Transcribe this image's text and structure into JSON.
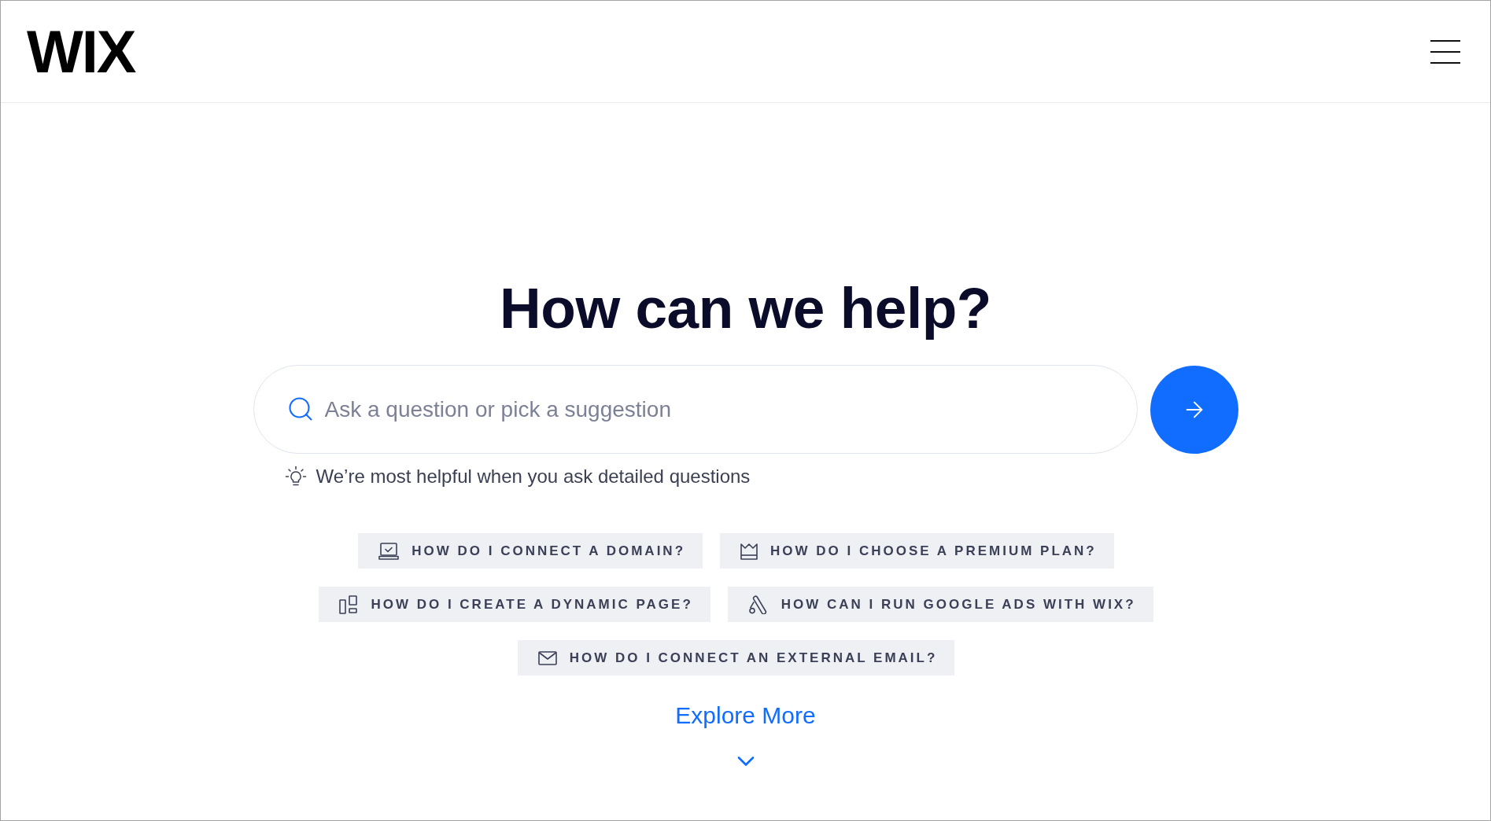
{
  "header": {
    "logo": "WIX"
  },
  "hero": {
    "title": "How can we help?"
  },
  "search": {
    "placeholder": "Ask a question or pick a suggestion"
  },
  "hint": "We’re most helpful when you ask detailed questions",
  "suggestion_rows": [
    [
      "HOW DO I CONNECT A DOMAIN?",
      "HOW DO I CHOOSE A PREMIUM PLAN?"
    ],
    [
      "HOW DO I CREATE A DYNAMIC PAGE?",
      "HOW CAN I RUN GOOGLE ADS WITH WIX?"
    ],
    [
      "HOW DO I CONNECT AN EXTERNAL EMAIL?"
    ]
  ],
  "explore_more": "Explore More"
}
